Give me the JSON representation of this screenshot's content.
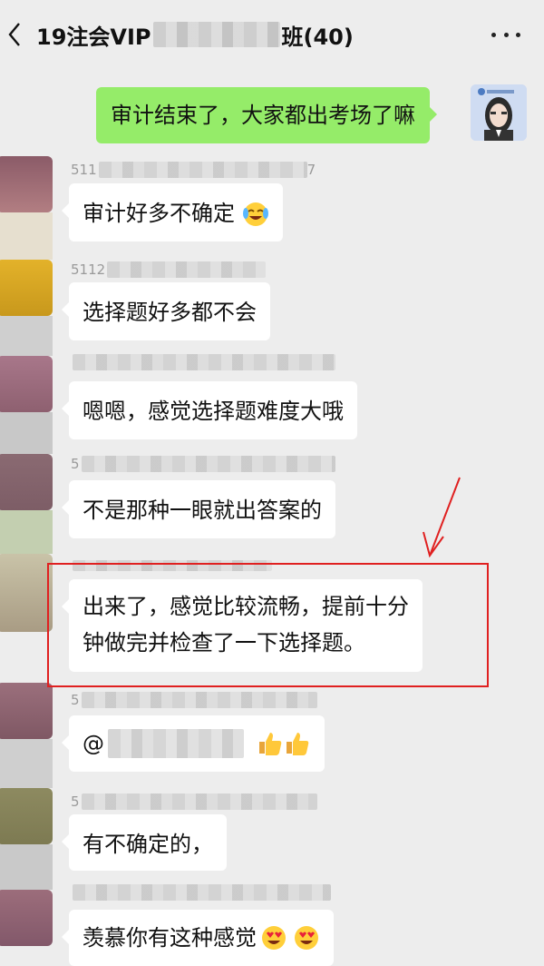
{
  "header": {
    "title_prefix": "19注会VIP",
    "title_suffix": "班(40)",
    "back_icon": "chevron-left-icon",
    "more_icon": "more-horizontal-icon"
  },
  "messages": [
    {
      "type": "self",
      "text": "审计结束了，大家都出考场了嘛"
    },
    {
      "type": "other",
      "sender_prefix": "511",
      "sender_suffix": "7",
      "text": "审计好多不确定",
      "emoji": "laughing-crying-emoji"
    },
    {
      "type": "other",
      "sender_prefix": "5112",
      "sender_suffix": "",
      "text": "选择题好多都不会"
    },
    {
      "type": "other",
      "sender_prefix": "",
      "sender_suffix": "",
      "text": "嗯嗯，感觉选择题难度大哦"
    },
    {
      "type": "other",
      "sender_prefix": "5",
      "sender_suffix": "",
      "text": "不是那种一眼就出答案的"
    },
    {
      "type": "other",
      "sender_prefix": "",
      "sender_suffix": "",
      "line1": "出来了，感觉比较流畅，提前十分",
      "line2": "钟做完并检查了一下选择题。",
      "highlighted": true
    },
    {
      "type": "other",
      "sender_prefix": "5",
      "sender_suffix": "",
      "text": "@",
      "emoji": "thumbs-up-emoji"
    },
    {
      "type": "other",
      "sender_prefix": "5",
      "sender_suffix": "",
      "text": "有不确定的，"
    },
    {
      "type": "other",
      "sender_prefix": "",
      "sender_suffix": "",
      "text": "羡慕你有这种感觉",
      "emoji": "heart-eyes-emoji"
    }
  ],
  "annotation_color": "#e02020",
  "self_bubble_color": "#95ec69"
}
